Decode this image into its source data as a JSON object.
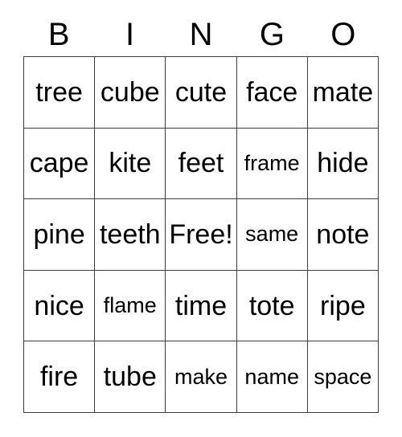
{
  "card": {
    "title": "BINGO",
    "header_letters": [
      "B",
      "I",
      "N",
      "G",
      "O"
    ],
    "grid_size": "5x5",
    "free_space_label": "Free!",
    "colors": {
      "background": "#ffffff",
      "text": "#000000",
      "grid_line": "#3c3c3c"
    },
    "rows": [
      {
        "cells": [
          {
            "text": "tree",
            "size": "large"
          },
          {
            "text": "cube",
            "size": "large"
          },
          {
            "text": "cute",
            "size": "large"
          },
          {
            "text": "face",
            "size": "large"
          },
          {
            "text": "mate",
            "size": "large"
          }
        ]
      },
      {
        "cells": [
          {
            "text": "cape",
            "size": "large"
          },
          {
            "text": "kite",
            "size": "large"
          },
          {
            "text": "feet",
            "size": "large"
          },
          {
            "text": "frame",
            "size": "small"
          },
          {
            "text": "hide",
            "size": "large"
          }
        ]
      },
      {
        "cells": [
          {
            "text": "pine",
            "size": "large"
          },
          {
            "text": "teeth",
            "size": "large"
          },
          {
            "text": "Free!",
            "size": "large"
          },
          {
            "text": "same",
            "size": "small"
          },
          {
            "text": "note",
            "size": "large"
          }
        ]
      },
      {
        "cells": [
          {
            "text": "nice",
            "size": "large"
          },
          {
            "text": "flame",
            "size": "small"
          },
          {
            "text": "time",
            "size": "large"
          },
          {
            "text": "tote",
            "size": "large"
          },
          {
            "text": "ripe",
            "size": "large"
          }
        ]
      },
      {
        "cells": [
          {
            "text": "fire",
            "size": "large"
          },
          {
            "text": "tube",
            "size": "large"
          },
          {
            "text": "make",
            "size": "small"
          },
          {
            "text": "name",
            "size": "small"
          },
          {
            "text": "space",
            "size": "small"
          }
        ]
      }
    ]
  }
}
